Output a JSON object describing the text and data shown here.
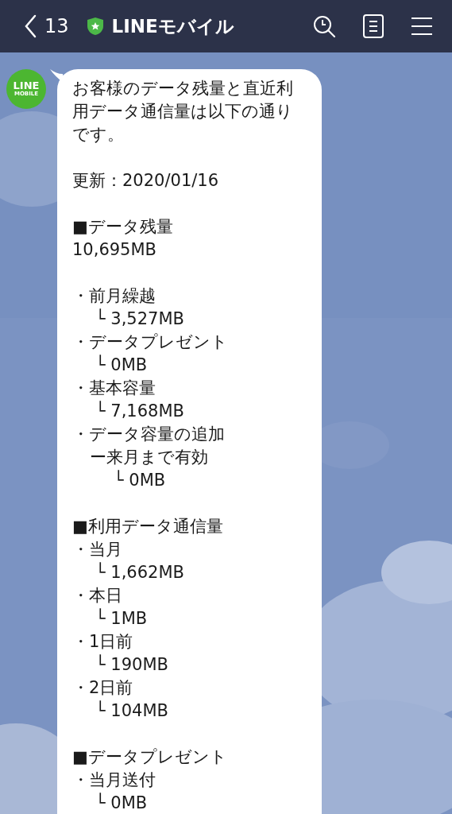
{
  "header": {
    "back_count": "13",
    "title": "LINEモバイル",
    "verified": true
  },
  "avatar": {
    "line1": "LINE",
    "line2": "MOBILE"
  },
  "message": {
    "intro": "お客様のデータ残量と直近利用データ通信量は以下の通りです。",
    "updated": "更新：2020/01/16",
    "sections": [
      {
        "heading": "■データ残量",
        "total": "10,695MB",
        "items": [
          {
            "label": "・前月繰越",
            "value": "└ 3,527MB"
          },
          {
            "label": "・データプレゼント",
            "value": "└ 0MB"
          },
          {
            "label": "・基本容量",
            "value": "└ 7,168MB"
          },
          {
            "label": "・データ容量の追加",
            "sublabel": "ー来月まで有効",
            "value": "└ 0MB"
          }
        ]
      },
      {
        "heading": "■利用データ通信量",
        "items": [
          {
            "label": "・当月",
            "value": "└ 1,662MB"
          },
          {
            "label": "・本日",
            "value": "└ 1MB"
          },
          {
            "label": "・1日前",
            "value": "└ 190MB"
          },
          {
            "label": "・2日前",
            "value": "└ 104MB"
          }
        ]
      },
      {
        "heading": "■データプレゼント",
        "items": [
          {
            "label": "・当月送付",
            "value": "└ 0MB"
          }
        ]
      }
    ]
  }
}
